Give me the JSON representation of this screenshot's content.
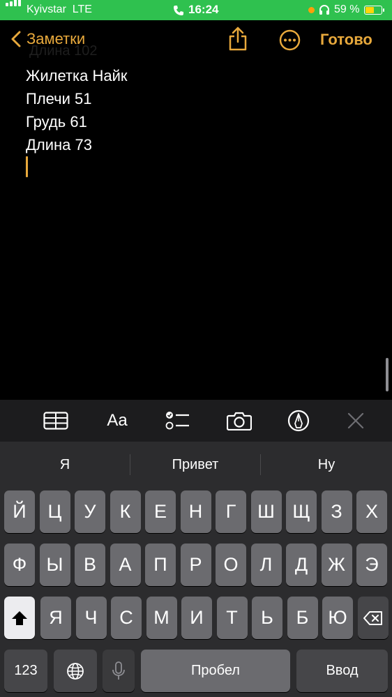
{
  "status_bar": {
    "carrier": "Kyivstar  LTE",
    "time": "16:24",
    "battery_percent": "59 %",
    "battery_level": 0.59
  },
  "nav": {
    "back_label": "Заметки",
    "done_label": "Готово"
  },
  "note": {
    "partially_hidden_line": "Длина 102",
    "lines": [
      "Жилетка Найк",
      "Плечи 51",
      "Грудь 61",
      "Длина 73"
    ]
  },
  "toolbar": {
    "format_label": "Aa"
  },
  "keyboard": {
    "predictions": [
      "Я",
      "Привет",
      "Ну"
    ],
    "rows": [
      [
        "Й",
        "Ц",
        "У",
        "К",
        "Е",
        "Н",
        "Г",
        "Ш",
        "Щ",
        "З",
        "Х"
      ],
      [
        "Ф",
        "Ы",
        "В",
        "А",
        "П",
        "Р",
        "О",
        "Л",
        "Д",
        "Ж",
        "Э"
      ],
      [
        "Я",
        "Ч",
        "С",
        "М",
        "И",
        "Т",
        "Ь",
        "Б",
        "Ю"
      ]
    ],
    "numbers_label": "123",
    "space_label": "Пробел",
    "return_label": "Ввод"
  },
  "colors": {
    "accent": "#e8a93c",
    "status_bar": "#2fc14f",
    "keyboard_bg": "#2c2c2e",
    "key": "#6b6b6f"
  }
}
